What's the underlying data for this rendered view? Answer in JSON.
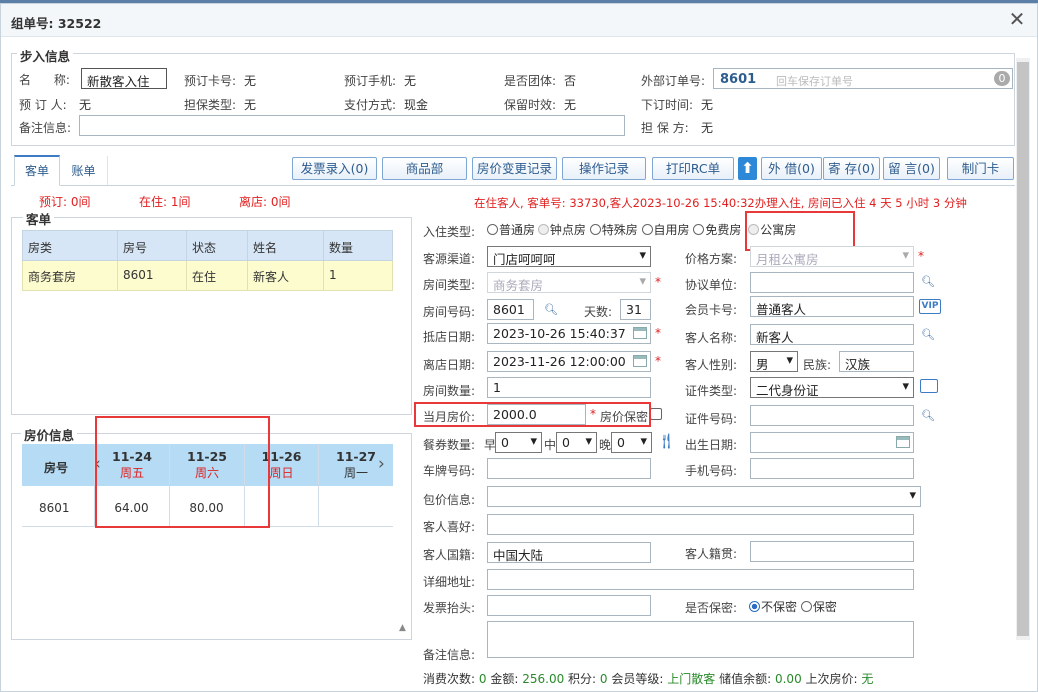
{
  "dialog": {
    "title": "组单号: 32522"
  },
  "step": {
    "legend": "步入信息",
    "name_label": "名      称:",
    "name_value": "新散客入住",
    "booking_card_label": "预订卡号:",
    "booking_card_value": "无",
    "booking_phone_label": "预订手机:",
    "booking_phone_value": "无",
    "is_group_label": "是否团体:",
    "is_group_value": "否",
    "external_order_label": "外部订单号:",
    "external_order_value": "8601",
    "external_order_placeholder": "回车保存订单号",
    "external_order_badge": "0",
    "booker_label": "预 订 人:",
    "booker_value": "无",
    "guarantee_type_label": "担保类型:",
    "guarantee_type_value": "无",
    "payment_label": "支付方式:",
    "payment_value": "现金",
    "retain_label": "保留时效:",
    "retain_value": "无",
    "order_time_label": "下订时间:",
    "order_time_value": "无",
    "remark_label": "备注信息:",
    "guarantor_label": "担 保 方:",
    "guarantor_value": "无"
  },
  "tabs": [
    {
      "label": "客单"
    },
    {
      "label": "账单"
    }
  ],
  "toolbar": [
    {
      "label": "发票录入(0)"
    },
    {
      "label": "商品部"
    },
    {
      "label": "房价变更记录"
    },
    {
      "label": "操作记录"
    },
    {
      "label": "打印RC单"
    },
    {
      "label": "外 借(0)"
    },
    {
      "label": "寄 存(0)"
    },
    {
      "label": "留 言(0)"
    },
    {
      "label": "制门卡"
    }
  ],
  "counts": {
    "reserved": "预订: 0间",
    "staying": "在住: 1间",
    "left": "离店: 0间"
  },
  "status_message": "在住客人, 客单号: 33730,客人2023-10-26 15:40:32办理入住, 房间已入住 4 天 5 小时 3 分钟",
  "guest_list": {
    "legend": "客单",
    "headers": [
      "房类",
      "房号",
      "状态",
      "姓名",
      "数量"
    ],
    "rows": [
      [
        "商务套房",
        "8601",
        "在住",
        "新客人",
        "1"
      ]
    ]
  },
  "price_info": {
    "legend": "房价信息",
    "room_header": "房号",
    "dates": [
      {
        "date": "11-24",
        "weekday": "周五"
      },
      {
        "date": "11-25",
        "weekday": "周六"
      },
      {
        "date": "11-26",
        "weekday": "周日"
      },
      {
        "date": "11-27",
        "weekday": "周一"
      }
    ],
    "room": "8601",
    "prices": [
      "64.00",
      "80.00",
      "",
      ""
    ]
  },
  "form": {
    "checkin_type_label": "入住类型:",
    "checkin_types": [
      "普通房",
      "钟点房",
      "特殊房",
      "自用房",
      "免费房",
      "公寓房"
    ],
    "checkin_type_selected": "公寓房",
    "source_label": "客源渠道:",
    "source_value": "门店呵呵呵",
    "price_plan_label": "价格方案:",
    "price_plan_value": "月租公寓房",
    "room_type_label": "房间类型:",
    "room_type_value": "商务套房",
    "agreement_label": "协议单位:",
    "agreement_value": "",
    "room_no_label": "房间号码:",
    "room_no_value": "8601",
    "days_label": "天数:",
    "days_value": "31",
    "member_card_label": "会员卡号:",
    "member_card_value": "普通客人",
    "vip_badge": "VIP",
    "arrival_label": "抵店日期:",
    "arrival_value": "2023-10-26 15:40:37",
    "guest_name_label": "客人名称:",
    "guest_name_value": "新客人",
    "departure_label": "离店日期:",
    "departure_value": "2023-11-26 12:00:00",
    "gender_label": "客人性别:",
    "gender_value": "男",
    "ethnicity_label": "民族:",
    "ethnicity_value": "汉族",
    "room_count_label": "房间数量:",
    "room_count_value": "1",
    "id_type_label": "证件类型:",
    "id_type_value": "二代身份证",
    "monthly_price_label": "当月房价:",
    "monthly_price_value": "2000.0",
    "price_confidential_label": "房价保密",
    "id_no_label": "证件号码:",
    "id_no_value": "",
    "meal_label": "餐券数量:",
    "breakfast_label": "早",
    "breakfast_value": "0",
    "lunch_label": "中",
    "lunch_value": "0",
    "dinner_label": "晚",
    "dinner_value": "0",
    "birth_label": "出生日期:",
    "birth_value": "",
    "plate_label": "车牌号码:",
    "plate_value": "",
    "mobile_label": "手机号码:",
    "mobile_value": "",
    "package_label": "包价信息:",
    "package_value": "",
    "hobby_label": "客人喜好:",
    "hobby_value": "",
    "nationality_label": "客人国籍:",
    "nationality_value": "中国大陆",
    "native_label": "客人籍贯:",
    "native_value": "",
    "address_label": "详细地址:",
    "address_value": "",
    "invoice_title_label": "发票抬头:",
    "invoice_title_value": "",
    "confidential_label": "是否保密:",
    "confidential_options": [
      "不保密",
      "保密"
    ],
    "confidential_selected": "不保密",
    "remark_label": "备注信息:",
    "remark_value": ""
  },
  "footer": {
    "consume_label": "消费次数:",
    "consume_value": "0",
    "amount_label": "金额:",
    "amount_value": "256.00",
    "points_label": "积分:",
    "points_value": "0",
    "level_label": "会员等级:",
    "level_value": "上门散客",
    "balance_label": "储值余额:",
    "balance_value": "0.00",
    "last_price_label": "上次房价:",
    "last_price_value": "无"
  },
  "colors": {
    "accent": "#2d5c8e",
    "highlight": "#e8383a",
    "grid_header": "#d7e6f6",
    "selected_row": "#fdfccf"
  }
}
